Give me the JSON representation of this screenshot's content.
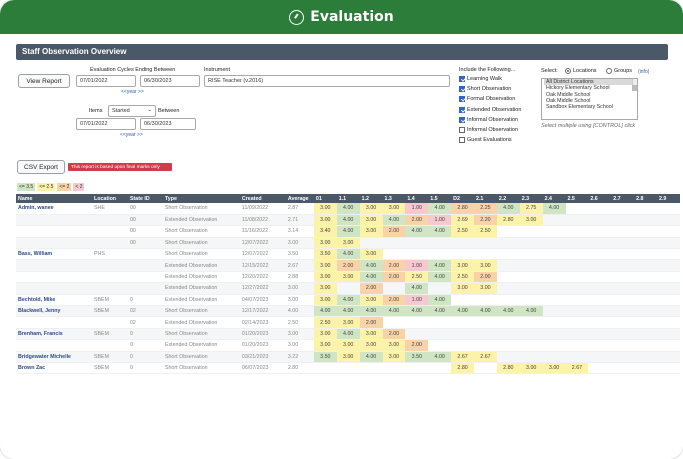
{
  "header": {
    "title": "Evaluation"
  },
  "panel": {
    "title": "Staff Observation Overview"
  },
  "filters": {
    "view_report": "View Report",
    "cycles_label": "Evaluation Cycles Ending Between",
    "cycle_start": "07/01/2022",
    "cycle_end": "06/30/2023",
    "year_link": "<<year >>",
    "instrument_label": "Instrument",
    "instrument_value": "RISE Teacher (v.2016)",
    "items_label": "Items",
    "items_select": "Started",
    "between_label": "Between",
    "items_start": "07/01/2022",
    "items_end": "06/30/2023",
    "items_year_link": "<<year >>"
  },
  "include": {
    "label": "Include the Following...",
    "options": [
      {
        "label": "Learning Walk",
        "checked": true
      },
      {
        "label": "Short Observation",
        "checked": true
      },
      {
        "label": "Formal Observation",
        "checked": true
      },
      {
        "label": "Extended Observation",
        "checked": true
      },
      {
        "label": "Informal Observation",
        "checked": true
      },
      {
        "label": "Informal Observation",
        "checked": false
      },
      {
        "label": "Guest Evaluations",
        "checked": false
      }
    ]
  },
  "select": {
    "label": "Select:",
    "radio_locations": "Locations",
    "radio_groups": "Groups",
    "info_link": "(info)",
    "options": [
      "All District Locations",
      "Hickory Elementary School",
      "Oak Middle School",
      "Oak Middle School",
      "Sandbox Elementary School"
    ],
    "hint": "Select multiple using [CONTROL] click"
  },
  "actions": {
    "csv_export": "CSV Export",
    "final_marks_note": "This report is based upon final marks only"
  },
  "legend": [
    "<= 3.5",
    "<= 2.5",
    "<= 2",
    "< 2"
  ],
  "colors": {
    "header_green": "#2c7d3a",
    "table_header": "#4a5868",
    "badge_red": "#d33a4a",
    "score_green": "#cfe5c3",
    "score_yellow": "#fdf3a8",
    "score_orange": "#f8d3a8",
    "score_pink": "#f5c9cf"
  },
  "table": {
    "columns": [
      "Name",
      "Location",
      "State ID",
      "Type",
      "Created",
      "Average",
      "01",
      "1.1",
      "1.2",
      "1.3",
      "1.4",
      "1.5",
      "D2",
      "2.1",
      "2.2",
      "2.3",
      "2.4",
      "2.5",
      "2.6",
      "2.7",
      "2.8",
      "2.9"
    ],
    "rows": [
      {
        "name": "Admin, wanee",
        "loc": "SHE",
        "sid": "00",
        "type": "Short Observation",
        "created": "11/09/2022",
        "avg": "2.87",
        "scores": [
          [
            "3.00",
            "y"
          ],
          [
            "4.00",
            "g"
          ],
          [
            "3.00",
            "y"
          ],
          [
            "3.00",
            "y"
          ],
          [
            "1.00",
            "p"
          ],
          [
            "4.00",
            "g"
          ],
          [
            "2.80",
            "o"
          ],
          [
            "2.25",
            "o"
          ],
          [
            "4.00",
            "g"
          ],
          [
            "2.75",
            "y"
          ],
          [
            "4.00",
            "g"
          ],
          [
            "",
            ""
          ],
          [
            "",
            ""
          ],
          [
            "",
            ""
          ],
          [
            "",
            ""
          ],
          [
            "",
            ""
          ]
        ]
      },
      {
        "name": "",
        "loc": "",
        "sid": "00",
        "type": "Extended Observation",
        "created": "11/08/2022",
        "avg": "2.71",
        "scores": [
          [
            "3.00",
            "y"
          ],
          [
            "4.00",
            "g"
          ],
          [
            "3.00",
            "y"
          ],
          [
            "4.00",
            "g"
          ],
          [
            "2.00",
            "o"
          ],
          [
            "1.00",
            "p"
          ],
          [
            "2.69",
            "y"
          ],
          [
            "2.20",
            "o"
          ],
          [
            "2.80",
            "y"
          ],
          [
            "3.00",
            "y"
          ],
          [
            "",
            ""
          ],
          [
            "",
            ""
          ],
          [
            "",
            ""
          ],
          [
            "",
            ""
          ],
          [
            "",
            ""
          ],
          [
            "",
            ""
          ]
        ]
      },
      {
        "name": "",
        "loc": "",
        "sid": "00",
        "type": "Short Observation",
        "created": "11/16/2022",
        "avg": "3.14",
        "scores": [
          [
            "3.40",
            "y"
          ],
          [
            "4.00",
            "g"
          ],
          [
            "3.00",
            "y"
          ],
          [
            "2.00",
            "o"
          ],
          [
            "4.00",
            "g"
          ],
          [
            "4.00",
            "g"
          ],
          [
            "2.50",
            "y"
          ],
          [
            "2.50",
            "y"
          ],
          [
            "",
            ""
          ],
          [
            "",
            ""
          ],
          [
            "",
            ""
          ],
          [
            "",
            ""
          ],
          [
            "",
            ""
          ],
          [
            "",
            ""
          ],
          [
            "",
            ""
          ],
          [
            "",
            ""
          ]
        ]
      },
      {
        "name": "",
        "loc": "",
        "sid": "00",
        "type": "Short Observation",
        "created": "12/07/2022",
        "avg": "3.00",
        "scores": [
          [
            "3.00",
            "y"
          ],
          [
            "3.00",
            "y"
          ],
          [
            "",
            ""
          ],
          [
            "",
            ""
          ],
          [
            "",
            ""
          ],
          [
            "",
            ""
          ],
          [
            "",
            ""
          ],
          [
            "",
            ""
          ],
          [
            "",
            ""
          ],
          [
            "",
            ""
          ],
          [
            "",
            ""
          ],
          [
            "",
            ""
          ],
          [
            "",
            ""
          ],
          [
            "",
            ""
          ],
          [
            "",
            ""
          ],
          [
            "",
            ""
          ]
        ]
      },
      {
        "name": "Bass, William",
        "loc": "PHS",
        "sid": "",
        "type": "Short Observation",
        "created": "12/07/2022",
        "avg": "3.50",
        "scores": [
          [
            "3.50",
            "y"
          ],
          [
            "4.00",
            "g"
          ],
          [
            "3.00",
            "y"
          ],
          [
            "",
            ""
          ],
          [
            "",
            ""
          ],
          [
            "",
            ""
          ],
          [
            "",
            ""
          ],
          [
            "",
            ""
          ],
          [
            "",
            ""
          ],
          [
            "",
            ""
          ],
          [
            "",
            ""
          ],
          [
            "",
            ""
          ],
          [
            "",
            ""
          ],
          [
            "",
            ""
          ],
          [
            "",
            ""
          ],
          [
            "",
            ""
          ]
        ]
      },
      {
        "name": "",
        "loc": "",
        "sid": "",
        "type": "Extended Observation",
        "created": "12/15/2022",
        "avg": "2.67",
        "scores": [
          [
            "3.00",
            "y"
          ],
          [
            "2.00",
            "o"
          ],
          [
            "4.00",
            "g"
          ],
          [
            "2.00",
            "o"
          ],
          [
            "1.00",
            "p"
          ],
          [
            "4.00",
            "g"
          ],
          [
            "3.00",
            "y"
          ],
          [
            "3.00",
            "y"
          ],
          [
            "",
            ""
          ],
          [
            "",
            ""
          ],
          [
            "",
            ""
          ],
          [
            "",
            ""
          ],
          [
            "",
            ""
          ],
          [
            "",
            ""
          ],
          [
            "",
            ""
          ],
          [
            "",
            ""
          ]
        ]
      },
      {
        "name": "",
        "loc": "",
        "sid": "",
        "type": "Extended Observation",
        "created": "12/20/2022",
        "avg": "2.88",
        "scores": [
          [
            "3.00",
            "y"
          ],
          [
            "3.00",
            "y"
          ],
          [
            "4.00",
            "g"
          ],
          [
            "2.00",
            "o"
          ],
          [
            "2.50",
            "y"
          ],
          [
            "4.00",
            "g"
          ],
          [
            "2.50",
            "y"
          ],
          [
            "2.00",
            "o"
          ],
          [
            "",
            ""
          ],
          [
            "",
            ""
          ],
          [
            "",
            ""
          ],
          [
            "",
            ""
          ],
          [
            "",
            ""
          ],
          [
            "",
            ""
          ],
          [
            "",
            ""
          ],
          [
            "",
            ""
          ]
        ]
      },
      {
        "name": "",
        "loc": "",
        "sid": "",
        "type": "Extended Observation",
        "created": "12/27/2022",
        "avg": "3.00",
        "scores": [
          [
            "3.00",
            "y"
          ],
          [
            "",
            ""
          ],
          [
            "2.00",
            "o"
          ],
          [
            "",
            ""
          ],
          [
            "4.00",
            "g"
          ],
          [
            "",
            ""
          ],
          [
            "3.00",
            "y"
          ],
          [
            "3.00",
            "y"
          ],
          [
            "",
            ""
          ],
          [
            "",
            ""
          ],
          [
            "",
            ""
          ],
          [
            "",
            ""
          ],
          [
            "",
            ""
          ],
          [
            "",
            ""
          ],
          [
            "",
            ""
          ],
          [
            "",
            ""
          ]
        ]
      },
      {
        "name": "Bechtold, Mike",
        "loc": "SBEM",
        "sid": "0",
        "type": "Extended Observation",
        "created": "04/07/2023",
        "avg": "3.00",
        "scores": [
          [
            "3.00",
            "y"
          ],
          [
            "4.00",
            "g"
          ],
          [
            "3.00",
            "y"
          ],
          [
            "2.00",
            "o"
          ],
          [
            "1.00",
            "p"
          ],
          [
            "4.00",
            "g"
          ],
          [
            "",
            ""
          ],
          [
            "",
            ""
          ],
          [
            "",
            ""
          ],
          [
            "",
            ""
          ],
          [
            "",
            ""
          ],
          [
            "",
            ""
          ],
          [
            "",
            ""
          ],
          [
            "",
            ""
          ],
          [
            "",
            ""
          ],
          [
            "",
            ""
          ]
        ]
      },
      {
        "name": "Blackwell, Jenny",
        "loc": "SBEM",
        "sid": "02",
        "type": "Short Observation",
        "created": "12/17/2022",
        "avg": "4.00",
        "scores": [
          [
            "4.00",
            "g"
          ],
          [
            "4.00",
            "g"
          ],
          [
            "4.00",
            "g"
          ],
          [
            "4.00",
            "g"
          ],
          [
            "4.00",
            "g"
          ],
          [
            "4.00",
            "g"
          ],
          [
            "4.00",
            "g"
          ],
          [
            "4.00",
            "g"
          ],
          [
            "4.00",
            "g"
          ],
          [
            "4.00",
            "g"
          ],
          [
            "",
            ""
          ],
          [
            "",
            ""
          ],
          [
            "",
            ""
          ],
          [
            "",
            ""
          ],
          [
            "",
            ""
          ],
          [
            "",
            ""
          ]
        ]
      },
      {
        "name": "",
        "loc": "",
        "sid": "02",
        "type": "Extended Observation",
        "created": "02/14/2023",
        "avg": "2.50",
        "scores": [
          [
            "2.50",
            "y"
          ],
          [
            "3.00",
            "y"
          ],
          [
            "2.00",
            "o"
          ],
          [
            "",
            ""
          ],
          [
            "",
            ""
          ],
          [
            "",
            ""
          ],
          [
            "",
            ""
          ],
          [
            "",
            ""
          ],
          [
            "",
            ""
          ],
          [
            "",
            ""
          ],
          [
            "",
            ""
          ],
          [
            "",
            ""
          ],
          [
            "",
            ""
          ],
          [
            "",
            ""
          ],
          [
            "",
            ""
          ],
          [
            "",
            ""
          ]
        ]
      },
      {
        "name": "Brenham, Francis",
        "loc": "SBEM",
        "sid": "0",
        "type": "Short Observation",
        "created": "01/20/2023",
        "avg": "3.00",
        "scores": [
          [
            "3.00",
            "y"
          ],
          [
            "4.00",
            "g"
          ],
          [
            "3.00",
            "y"
          ],
          [
            "2.00",
            "o"
          ],
          [
            "",
            ""
          ],
          [
            "",
            ""
          ],
          [
            "",
            ""
          ],
          [
            "",
            ""
          ],
          [
            "",
            ""
          ],
          [
            "",
            ""
          ],
          [
            "",
            ""
          ],
          [
            "",
            ""
          ],
          [
            "",
            ""
          ],
          [
            "",
            ""
          ],
          [
            "",
            ""
          ],
          [
            "",
            ""
          ]
        ]
      },
      {
        "name": "",
        "loc": "",
        "sid": "0",
        "type": "Extended Observation",
        "created": "01/20/2023",
        "avg": "3.00",
        "scores": [
          [
            "3.00",
            "y"
          ],
          [
            "3.00",
            "y"
          ],
          [
            "3.00",
            "y"
          ],
          [
            "3.00",
            "y"
          ],
          [
            "2.00",
            "o"
          ],
          [
            "",
            ""
          ],
          [
            "",
            ""
          ],
          [
            "",
            ""
          ],
          [
            "",
            ""
          ],
          [
            "",
            ""
          ],
          [
            "",
            ""
          ],
          [
            "",
            ""
          ],
          [
            "",
            ""
          ],
          [
            "",
            ""
          ],
          [
            "",
            ""
          ],
          [
            "",
            ""
          ]
        ]
      },
      {
        "name": "Bridgewater Michelle",
        "loc": "SBEM",
        "sid": "0",
        "type": "Short Observation",
        "created": "03/21/2023",
        "avg": "3.22",
        "scores": [
          [
            "3.50",
            "g"
          ],
          [
            "3.00",
            "y"
          ],
          [
            "4.00",
            "g"
          ],
          [
            "3.00",
            "y"
          ],
          [
            "3.50",
            "g"
          ],
          [
            "4.00",
            "g"
          ],
          [
            "2.67",
            "y"
          ],
          [
            "2.67",
            "y"
          ],
          [
            "",
            ""
          ],
          [
            "",
            ""
          ],
          [
            "",
            ""
          ],
          [
            "",
            ""
          ],
          [
            "",
            ""
          ],
          [
            "",
            ""
          ],
          [
            "",
            ""
          ],
          [
            "",
            ""
          ]
        ]
      },
      {
        "name": "Brown Zac",
        "loc": "SBEM",
        "sid": "0",
        "type": "Short Observation",
        "created": "06/07/2023",
        "avg": "2.80",
        "scores": [
          [
            "",
            ""
          ],
          [
            "",
            ""
          ],
          [
            "",
            ""
          ],
          [
            "",
            ""
          ],
          [
            "",
            ""
          ],
          [
            "",
            ""
          ],
          [
            "2.80",
            "y"
          ],
          [
            "",
            ""
          ],
          [
            "2.80",
            "y"
          ],
          [
            "3.00",
            "y"
          ],
          [
            "3.00",
            "y"
          ],
          [
            "2.67",
            "y"
          ],
          [
            "",
            ""
          ],
          [
            "",
            ""
          ],
          [
            "",
            ""
          ],
          [
            "",
            ""
          ]
        ]
      }
    ]
  }
}
